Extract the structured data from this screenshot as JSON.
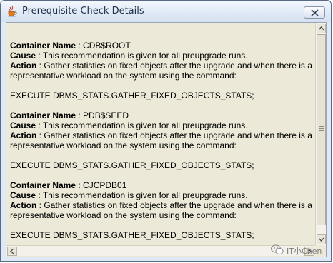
{
  "window": {
    "title": "Prerequisite Check Details"
  },
  "labels": {
    "container_name": "Container Name",
    "cause": "Cause",
    "action": "Action",
    "sep": " : "
  },
  "entries": [
    {
      "container": "CDB$ROOT",
      "cause": "This recommendation is given for all preupgrade runs.",
      "action": "Gather statistics on fixed objects after the upgrade and when there is a representative workload on the system using the command:",
      "command": "EXECUTE DBMS_STATS.GATHER_FIXED_OBJECTS_STATS;"
    },
    {
      "container": "PDB$SEED",
      "cause": "This recommendation is given for all preupgrade runs.",
      "action": "Gather statistics on fixed objects after the upgrade and when there is a representative workload on the system using the command:",
      "command": "EXECUTE DBMS_STATS.GATHER_FIXED_OBJECTS_STATS;"
    },
    {
      "container": "CJCPDB01",
      "cause": "This recommendation is given for all preupgrade runs.",
      "action": "Gather statistics on fixed objects after the upgrade and when there is a representative workload on the system using the command:",
      "command": "EXECUTE DBMS_STATS.GATHER_FIXED_OBJECTS_STATS;"
    }
  ],
  "watermark": {
    "text": "IT小Chen"
  },
  "icons": {
    "app": "java-cup-icon",
    "close": "close-icon",
    "scroll_up": "arrow-up-icon",
    "scroll_down": "arrow-down-icon",
    "scroll_left": "arrow-left-icon",
    "scroll_right": "arrow-right-icon"
  }
}
